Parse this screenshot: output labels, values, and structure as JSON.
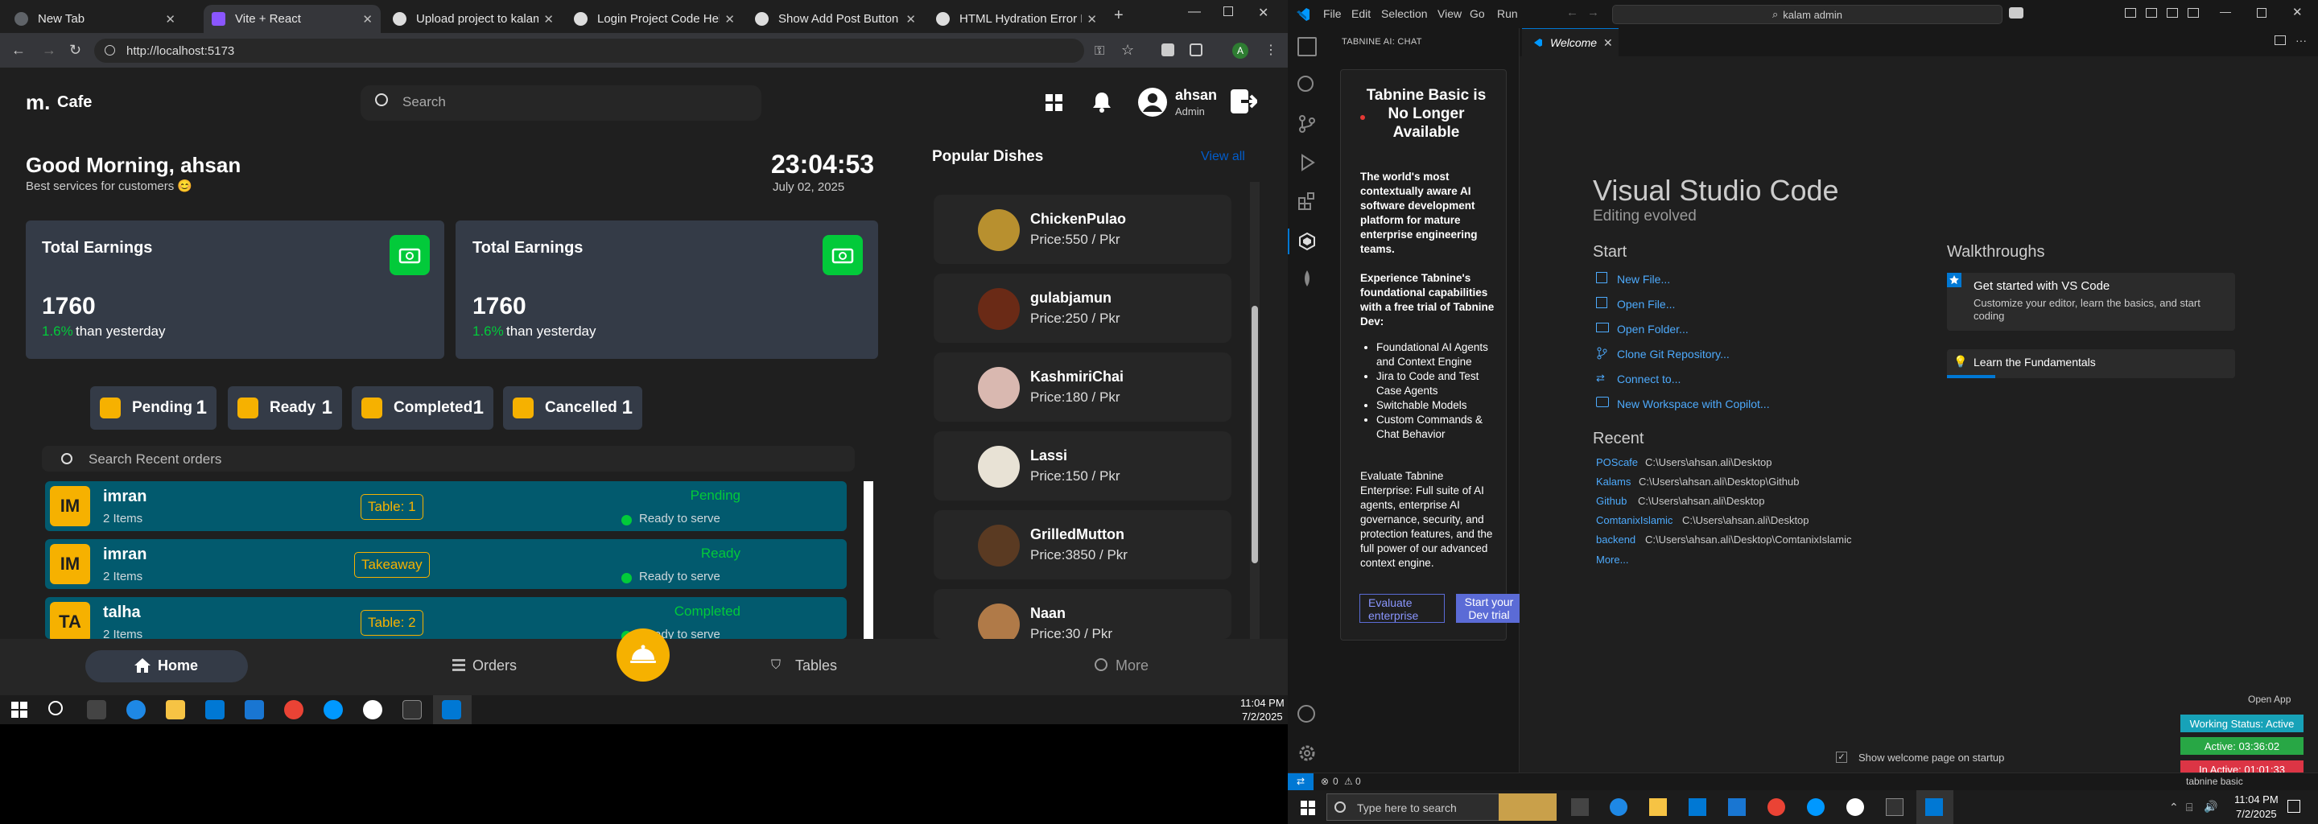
{
  "chrome": {
    "tabs": [
      {
        "title": "New Tab",
        "color": "#5f6368"
      },
      {
        "title": "Vite + React",
        "color": "#8a56ff"
      },
      {
        "title": "Upload project to kalams.org",
        "color": "#e8e8e8"
      },
      {
        "title": "Login Project Code Help",
        "color": "#e8e8e8"
      },
      {
        "title": "Show Add Post Button",
        "color": "#e8e8e8"
      },
      {
        "title": "HTML Hydration Error Fix",
        "color": "#e8e8e8"
      }
    ],
    "url": "http://localhost:5173"
  },
  "app": {
    "logo": "Cafe",
    "search_placeholder": "Search",
    "user": {
      "name": "ahsan",
      "role": "Admin"
    },
    "greeting": "Good Morning, ahsan",
    "greeting_sub": "Best services for customers 😊",
    "time": "23:04:53",
    "date": "July 02, 2025",
    "earnings": [
      {
        "title": "Total Earnings",
        "value": "1760",
        "pct": "1.6%",
        "suffix": "than yesterday"
      },
      {
        "title": "Total Earnings",
        "value": "1760",
        "pct": "1.6%",
        "suffix": "than yesterday"
      }
    ],
    "status_pills": [
      {
        "label": "Pending",
        "count": "1"
      },
      {
        "label": "Ready",
        "count": "1"
      },
      {
        "label": "Completed",
        "count": "1"
      },
      {
        "label": "Cancelled",
        "count": "1"
      }
    ],
    "orders_search_placeholder": "Search Recent orders",
    "orders": [
      {
        "initials": "IM",
        "name": "imran",
        "items": "2 Items",
        "table": "Table: 1",
        "status": "Pending",
        "ready": "Ready to serve"
      },
      {
        "initials": "IM",
        "name": "imran",
        "items": "2 Items",
        "table": "Takeaway",
        "status": "Ready",
        "ready": "Ready to serve"
      },
      {
        "initials": "TA",
        "name": "talha",
        "items": "2 Items",
        "table": "Table: 2",
        "status": "Completed",
        "ready": "Ready to serve"
      }
    ],
    "popular_title": "Popular Dishes",
    "view_all": "View all",
    "dishes": [
      {
        "name": "ChickenPulao",
        "price": "Price:550 / Pkr",
        "color": "#b8902f"
      },
      {
        "name": "gulabjamun",
        "price": "Price:250 / Pkr",
        "color": "#6a2a16"
      },
      {
        "name": "KashmiriChai",
        "price": "Price:180 / Pkr",
        "color": "#d9b8b0"
      },
      {
        "name": "Lassi",
        "price": "Price:150 / Pkr",
        "color": "#e8e2d5"
      },
      {
        "name": "GrilledMutton",
        "price": "Price:3850 / Pkr",
        "color": "#5a3a22"
      },
      {
        "name": "Naan",
        "price": "Price:30 / Pkr",
        "color": "#b07a48"
      }
    ],
    "nav": {
      "home": "Home",
      "orders": "Orders",
      "tables": "Tables",
      "more": "More"
    }
  },
  "taskbar_left": {
    "time": "11:04 PM",
    "date": "7/2/2025"
  },
  "vscode": {
    "menu": [
      "File",
      "Edit",
      "Selection",
      "View",
      "Go",
      "Run"
    ],
    "search": "kalam admin",
    "side_title": "TABNINE AI: CHAT",
    "tabnine": {
      "heading": "Tabnine Basic is No Longer Available",
      "p1": "The world's most contextually aware AI software development platform for mature enterprise engineering teams.",
      "p2": "Experience Tabnine's foundational capabilities with a free trial of Tabnine Dev:",
      "bullets": [
        "Foundational AI Agents and Context Engine",
        "Jira to Code and Test Case Agents",
        "Switchable Models",
        "Custom Commands & Chat Behavior"
      ],
      "p3": "Evaluate Tabnine Enterprise: Full suite of AI agents, enterprise AI governance, security, and protection features, and the full power of our advanced context engine.",
      "btn1": "Evaluate enterprise",
      "btn2": "Start your Dev trial"
    },
    "tab": "Welcome",
    "title": "Visual Studio Code",
    "subtitle": "Editing evolved",
    "start_title": "Start",
    "start": [
      "New File...",
      "Open File...",
      "Open Folder...",
      "Clone Git Repository...",
      "Connect to...",
      "New Workspace with Copilot..."
    ],
    "recent_title": "Recent",
    "recent": [
      {
        "name": "POScafe",
        "path": "C:\\Users\\ahsan.ali\\Desktop"
      },
      {
        "name": "Kalams",
        "path": "C:\\Users\\ahsan.ali\\Desktop\\Github"
      },
      {
        "name": "Github",
        "path": "C:\\Users\\ahsan.ali\\Desktop"
      },
      {
        "name": "ComtanixIslamic",
        "path": "C:\\Users\\ahsan.ali\\Desktop"
      },
      {
        "name": "backend",
        "path": "C:\\Users\\ahsan.ali\\Desktop\\ComtanixIslamic"
      }
    ],
    "more": "More...",
    "walk_title": "Walkthroughs",
    "walk1_title": "Get started with VS Code",
    "walk1_desc": "Customize your editor, learn the basics, and start coding",
    "walk2_title": "Learn the Fundamentals",
    "show_welcome": "Show welcome page on startup",
    "open_app": "Open App",
    "working_status": "Working Status: Active",
    "active": "Active: 03:36:02",
    "inactive": "In Active: 01:01:33",
    "status_errors": "0",
    "status_warnings": "0",
    "status_right": "tabnine basic"
  },
  "taskbar_right": {
    "search_placeholder": "Type here to search",
    "time": "11:04 PM",
    "date": "7/2/2025"
  }
}
